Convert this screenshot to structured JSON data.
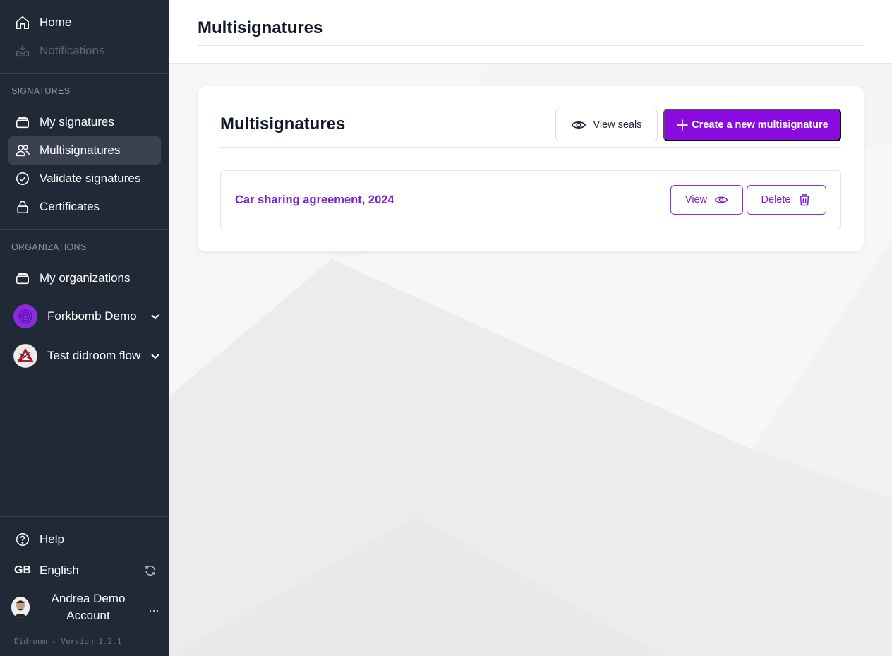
{
  "sidebar": {
    "home": "Home",
    "notifications": "Notifications",
    "signatures_section": "SIGNATURES",
    "my_signatures": "My signatures",
    "multisignatures": "Multisignatures",
    "validate_signatures": "Validate signatures",
    "certificates": "Certificates",
    "organizations_section": "ORGANIZATIONS",
    "my_organizations": "My organizations",
    "orgs": [
      {
        "name": "Forkbomb Demo",
        "icon": "fingerprint-icon"
      },
      {
        "name": "Test didroom flow",
        "icon": "org-logo-icon"
      }
    ],
    "help": "Help",
    "language_code": "GB",
    "language": "English",
    "user_name": "Andrea Demo Account",
    "more": "...",
    "version": "Didroom - Version 1.2.1"
  },
  "header": {
    "title": "Multisignatures"
  },
  "card": {
    "title": "Multisignatures",
    "view_seals": "View seals",
    "create_new": "Create a new multisignature",
    "items": [
      {
        "title": "Car sharing agreement, 2024",
        "view": "View",
        "delete": "Delete"
      }
    ]
  },
  "colors": {
    "sidebar_bg": "#212936",
    "accent": "#8a0be0",
    "accent_text": "#7e1fd0"
  }
}
